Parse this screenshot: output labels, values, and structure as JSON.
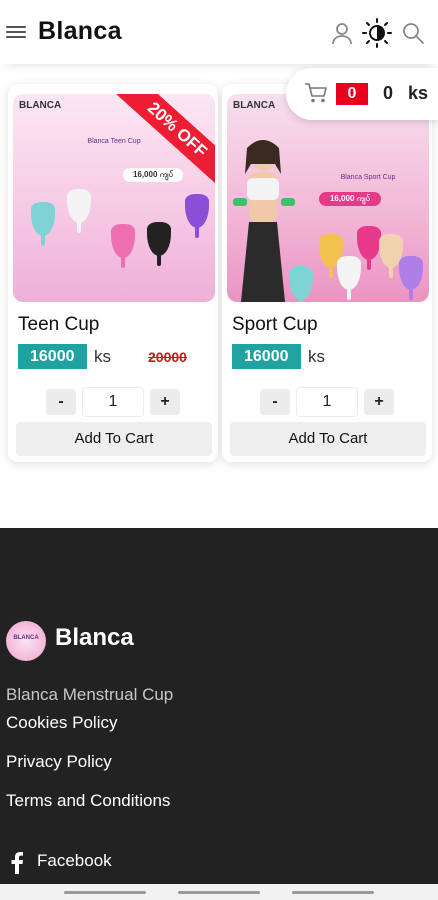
{
  "header": {
    "brand": "Blanca",
    "icons": [
      "menu-icon",
      "user-icon",
      "theme-toggle-icon",
      "search-icon"
    ]
  },
  "cart": {
    "icon": "cart-icon",
    "count": "0",
    "total": "0 ks",
    "count_color": "#e8001c"
  },
  "products": [
    {
      "title": "Teen Cup",
      "price": "16000",
      "unit": "ks",
      "old_price": "20000",
      "badge": "20% OFF",
      "quantity": "1",
      "minus_label": "-",
      "plus_label": "+",
      "add_label": "Add To Cart",
      "image": {
        "logo": "BLANCA",
        "caption": "Blanca Teen Cup",
        "price_tag": "16,000 ကျပ်"
      }
    },
    {
      "title": "Sport Cup",
      "price": "16000",
      "unit": "ks",
      "quantity": "1",
      "minus_label": "-",
      "plus_label": "+",
      "add_label": "Add To Cart",
      "image": {
        "logo": "BLANCA",
        "caption": "Blanca Sport Cup",
        "price_tag": "16,000 ကျပ်"
      }
    }
  ],
  "footer": {
    "logo_text": "BLANCA",
    "brand": "Blanca",
    "subtitle": "Blanca Menstrual Cup",
    "links": [
      "Cookies Policy",
      "Privacy Policy",
      "Terms and Conditions"
    ],
    "social": "Facebook"
  },
  "colors": {
    "price_badge": "#1fa2a0",
    "sale_ribbon": "#ee1d34",
    "footer_bg": "#222222"
  }
}
